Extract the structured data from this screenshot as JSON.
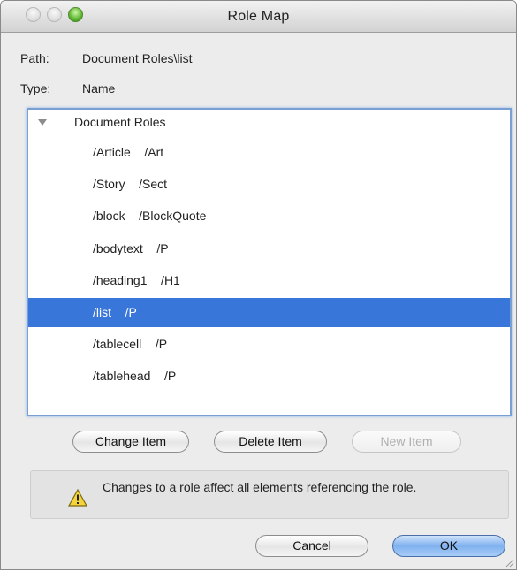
{
  "window": {
    "title": "Role Map"
  },
  "info": {
    "path_label": "Path:",
    "path_value": "Document Roles\\list",
    "type_label": "Type:",
    "type_value": "Name"
  },
  "tree": {
    "root_label": "Document Roles",
    "items": [
      {
        "text": "/Article    /Art",
        "selected": false
      },
      {
        "text": "/Story    /Sect",
        "selected": false
      },
      {
        "text": "/block    /BlockQuote",
        "selected": false
      },
      {
        "text": "/bodytext    /P",
        "selected": false
      },
      {
        "text": "/heading1    /H1",
        "selected": false
      },
      {
        "text": "/list    /P",
        "selected": true
      },
      {
        "text": "/tablecell    /P",
        "selected": false
      },
      {
        "text": "/tablehead    /P",
        "selected": false
      }
    ]
  },
  "buttons": {
    "change_item": "Change Item",
    "delete_item": "Delete Item",
    "new_item": "New Item",
    "cancel": "Cancel",
    "ok": "OK"
  },
  "notice": {
    "icon": "warning-icon",
    "text": "Changes to a role affect all elements referencing the role."
  },
  "colors": {
    "selection": "#3876d9",
    "list_focus_ring": "#7a9fd3",
    "primary_button": "#7fb1ef"
  }
}
